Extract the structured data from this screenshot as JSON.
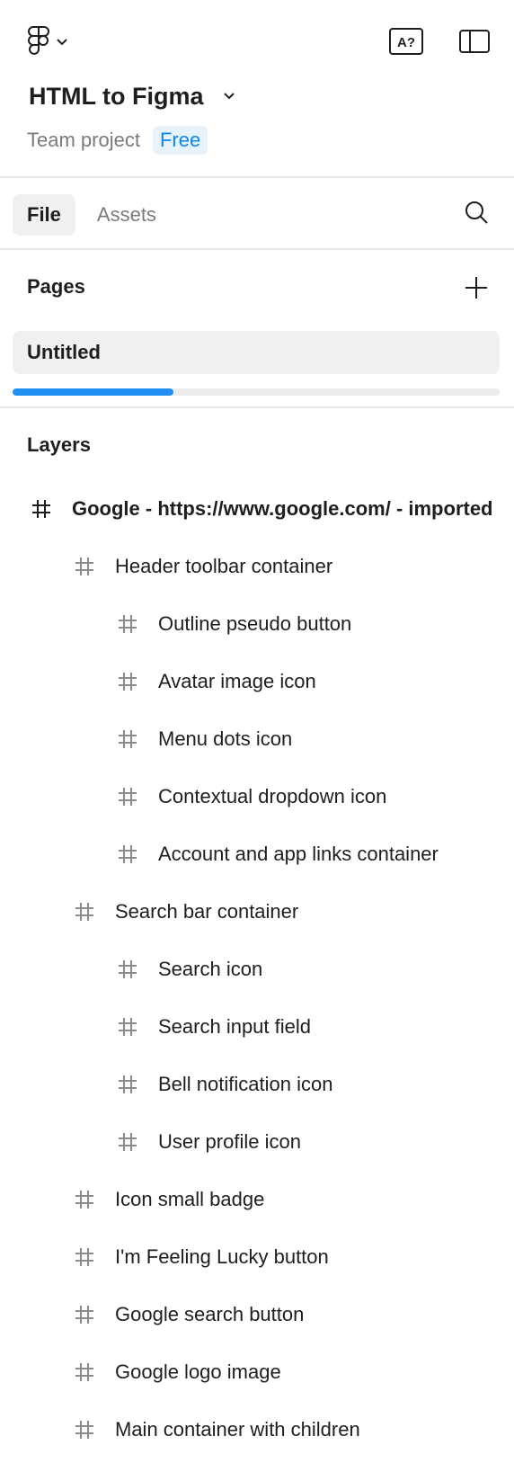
{
  "header": {
    "project_title": "HTML to Figma",
    "project_type": "Team project",
    "plan_badge": "Free",
    "icons": [
      "figma-logo-icon",
      "chevron-down-icon",
      "font-check-icon",
      "sidebar-toggle-icon"
    ]
  },
  "tabs": [
    {
      "label": "File",
      "active": true
    },
    {
      "label": "Assets",
      "active": false
    }
  ],
  "pages": {
    "title": "Pages",
    "items": [
      {
        "label": "Untitled",
        "selected": true
      }
    ],
    "scroll_progress": 0.33
  },
  "layers": {
    "title": "Layers",
    "items": [
      {
        "label": "Google - https://www.google.com/ - imported",
        "depth": 0
      },
      {
        "label": "Header toolbar container",
        "depth": 1
      },
      {
        "label": "Outline pseudo button",
        "depth": 2
      },
      {
        "label": "Avatar image icon",
        "depth": 2
      },
      {
        "label": "Menu dots icon",
        "depth": 2
      },
      {
        "label": "Contextual dropdown icon",
        "depth": 2
      },
      {
        "label": "Account and app links container",
        "depth": 2
      },
      {
        "label": "Search bar container",
        "depth": 1
      },
      {
        "label": "Search icon",
        "depth": 2
      },
      {
        "label": "Search input field",
        "depth": 2
      },
      {
        "label": "Bell notification icon",
        "depth": 2
      },
      {
        "label": "User profile icon",
        "depth": 2
      },
      {
        "label": "Icon small badge",
        "depth": 1
      },
      {
        "label": "I'm Feeling Lucky button",
        "depth": 1
      },
      {
        "label": "Google search button",
        "depth": 1
      },
      {
        "label": "Google logo image",
        "depth": 1
      },
      {
        "label": "Main container with children",
        "depth": 1
      }
    ]
  },
  "colors": {
    "accent": "#0d86e8",
    "badge_bg": "#e6f3fd",
    "scroll_thumb": "#1f8ff2",
    "selected_bg": "#f0f0f0",
    "muted_text": "#7a7a7a"
  }
}
